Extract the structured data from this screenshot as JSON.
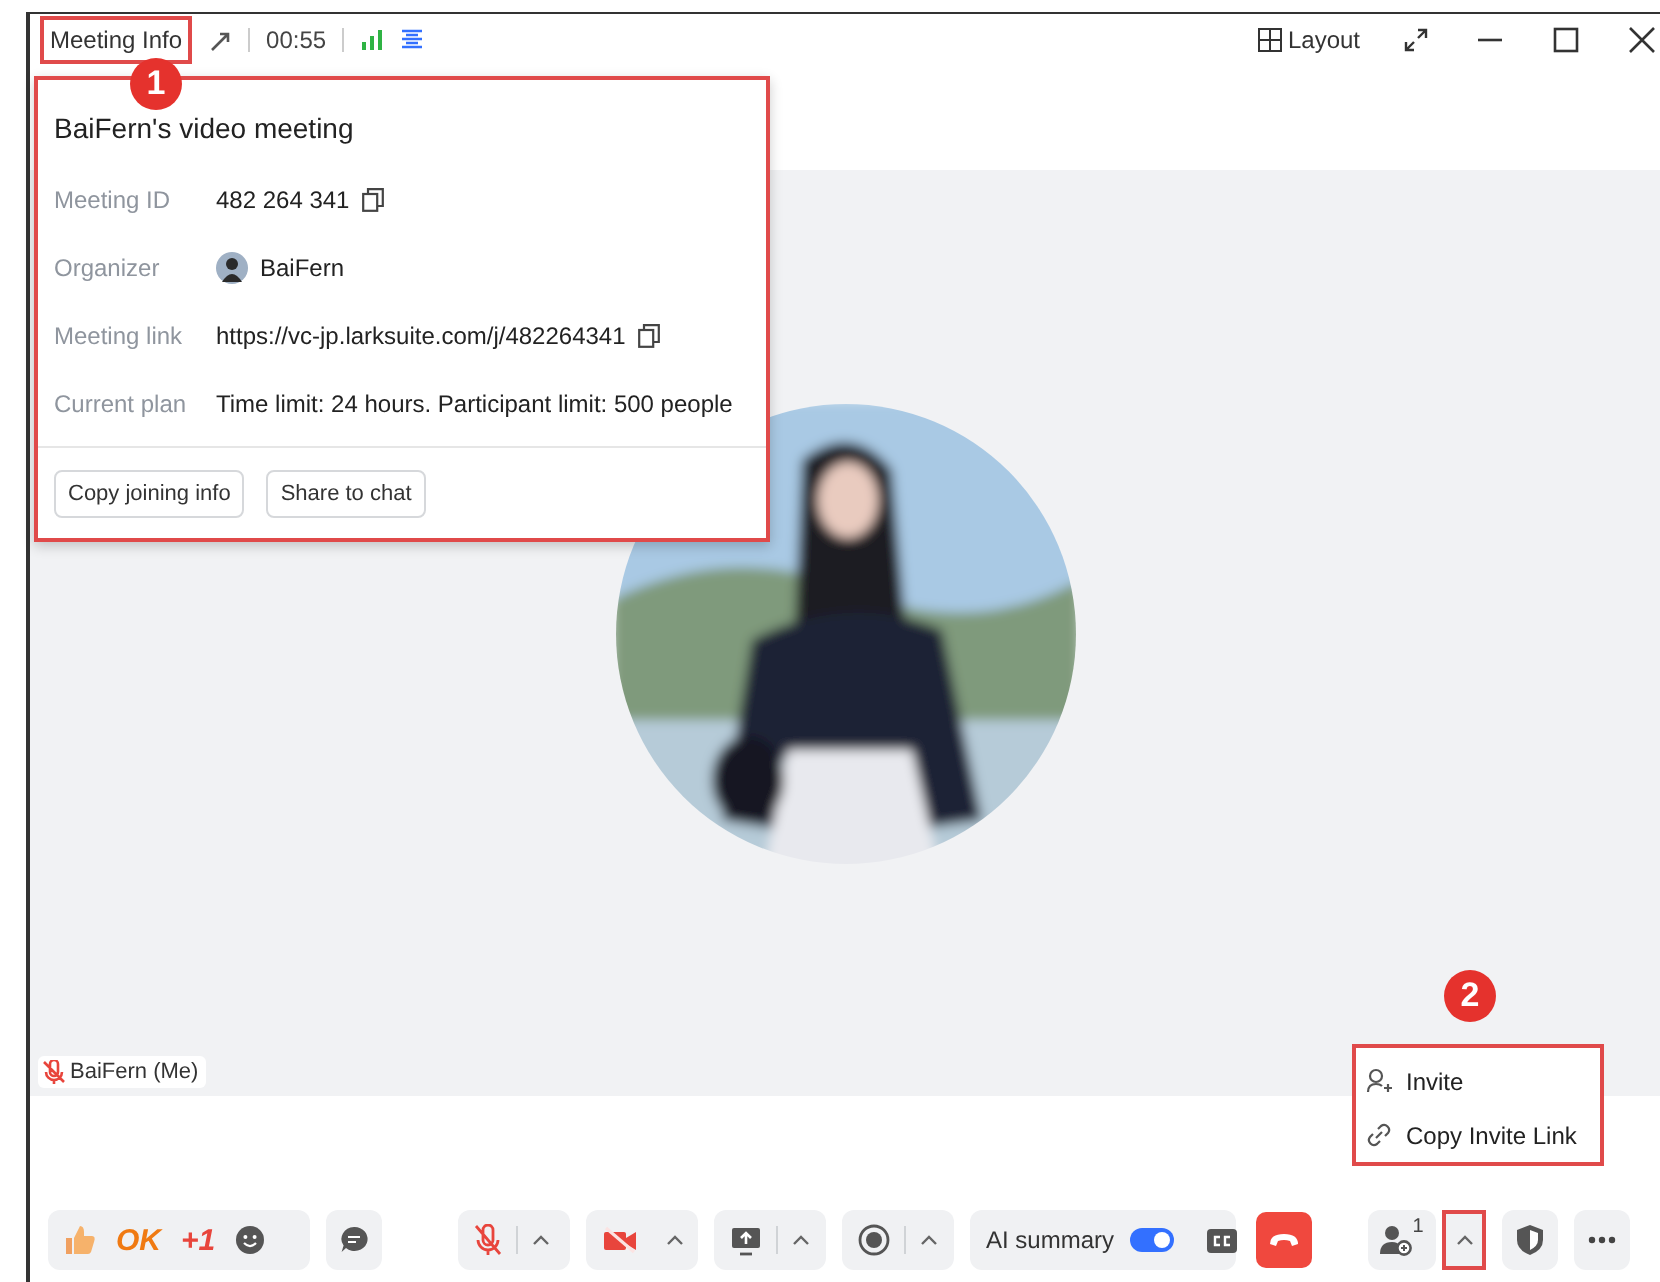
{
  "top_bar": {
    "meeting_info": "Meeting Info",
    "timer": "00:55",
    "layout": "Layout"
  },
  "info_popup": {
    "title": "BaiFern's video meeting",
    "rows": [
      {
        "label": "Meeting ID",
        "value": "482 264 341",
        "kind": "copy"
      },
      {
        "label": "Organizer",
        "value": "BaiFern",
        "kind": "person"
      },
      {
        "label": "Meeting link",
        "value": "https://vc-jp.larksuite.com/j/482264341",
        "kind": "copy"
      },
      {
        "label": "Current plan",
        "value": "Time limit: 24 hours. Participant limit: 500 people",
        "kind": "text"
      }
    ],
    "buttons": [
      "Copy joining info",
      "Share to chat"
    ]
  },
  "participant": {
    "name": "BaiFern (Me)",
    "muted": true
  },
  "invite_menu": {
    "items": [
      {
        "label": "Invite",
        "kind": "invite"
      },
      {
        "label": "Copy Invite Link",
        "kind": "link"
      }
    ]
  },
  "toolbar": {
    "reactions": [
      {
        "label": "OK",
        "color": "#f07a12"
      },
      {
        "label": "+1",
        "color": "#e8453c"
      }
    ],
    "mic_muted": true,
    "camera_off": true,
    "ai_summary": {
      "label": "AI summary",
      "on": true
    },
    "participant_count": "1"
  },
  "annotations": [
    {
      "number": "1"
    },
    {
      "number": "2"
    }
  ]
}
